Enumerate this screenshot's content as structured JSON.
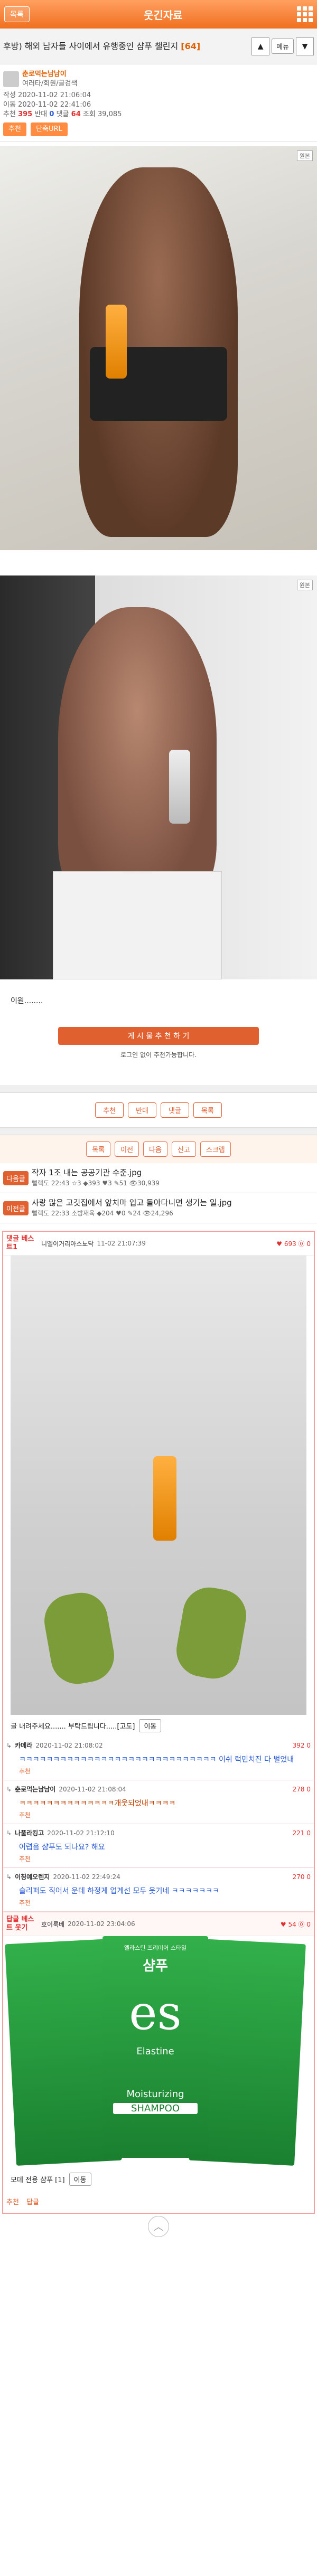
{
  "header": {
    "back_label": "목록",
    "title": "웃긴자료"
  },
  "post": {
    "title": "후방) 해외 남자들 사이에서 유행중인 샴푸 챌린지",
    "comment_count": "[64]",
    "up_label": "▲",
    "down_label": "▼",
    "memo_label": "메뉴",
    "author_name": "춘로먹는남남이",
    "author_sub": "여러타/회원/글검색",
    "written": "작성 2020-11-02 21:06:04",
    "edited": "이동 2020-11-02 22:41:06",
    "stats_prefix": "추천",
    "recommend": "395",
    "oppose_label": "반대",
    "oppose": "0",
    "reply_label": "댓글",
    "reply_count": "64",
    "views_label": "조회",
    "views": "39,085",
    "btn_recommend": "추천",
    "btn_link": "단축URL",
    "body_text": "이원........",
    "report_button": "게 시 물 추 천 하 기",
    "note": "로그인 없이 추천가능합니다."
  },
  "watermarks": {
    "w1": "원본",
    "w2": "원본"
  },
  "actions": {
    "recommend": "추천",
    "oppose": "반대",
    "reply": "댓글",
    "list": "목록"
  },
  "nav": {
    "list": "목록",
    "prev": "이전",
    "next": "다음",
    "report": "신고",
    "share": "스크랩"
  },
  "adjacent": [
    {
      "label": "다음글",
      "title": "작자 1조 내는 공공기관 수준.jpg",
      "meta": "뻘랙도 22:43 ☆3 ◆393 ♥3 ✎51 👁30,939"
    },
    {
      "label": "이전글",
      "title": "사랑 많은 고깃집에서 앞치마 입고 돌아다니면 생기는 일.jpg",
      "meta": "뻘랙도 22:33 소방재육 ◆204 ♥0 ✎24 👁24,296"
    }
  ],
  "best1": {
    "tag": "댓글 베스트1",
    "name": "니엘이거리아스뇨닥",
    "time": "11-02 21:07:39",
    "votes": "♥ 693 ⓪ 0",
    "caption": "글 내려주세요....... 부탁드립니다.....[고도]",
    "move": "이동"
  },
  "replies": [
    {
      "name": "카메라",
      "time": "2020-11-02 21:08:02",
      "votes": "392 0",
      "body": "ㅋㅋㅋㅋㅋㅋㅋㅋㅋㅋㅋㅋㅋㅋㅋㅋㅋㅋㅋㅋㅋㅋㅋㅋㅋㅋㅋㅋㅋ 이쉬 럭민치진 다 벌었내",
      "rec": "추천"
    },
    {
      "name": "춘로먹는남남이",
      "time": "2020-11-02 21:08:04",
      "votes": "278 0",
      "body": "ㅋㅋㅋㅋㅋㅋㅋㅋㅋㅋㅋㅋㅋㅋ개웃되었내ㅋㅋㅋㅋ",
      "rec": "추천"
    },
    {
      "name": "나풀라킹고",
      "time": "2020-11-02 21:12:10",
      "votes": "221 0",
      "body": "어렵음 샴푸도 되나요? 해요",
      "rec": "추천"
    },
    {
      "name": "이칭예오렌지",
      "time": "2020-11-02 22:49:24",
      "votes": "270 0",
      "body": "슬리퍼도 직어서 운데 하정게 업계선 모두 웃기네 ㅋㅋㅋㅋㅋㅋㅋ",
      "rec": "추천"
    }
  ],
  "best2": {
    "tag": "답글 베스트 웃기",
    "name": "호이룩베",
    "time": "2020-11-02 23:04:06",
    "votes": "♥ 54 ⓪ 0",
    "sachet_brand": "샴푸",
    "sachet_top": "엘라스틴 프리미어 스타일",
    "sachet_logo": "es",
    "sachet_name": "Elastine",
    "sachet_sub": "Moisturizing",
    "sachet_type": "SHAMPOO",
    "caption": "모데 전용 샴푸 [1]",
    "move": "이동",
    "rec": "추천",
    "rep": "답글"
  },
  "scroll_top": "︿"
}
